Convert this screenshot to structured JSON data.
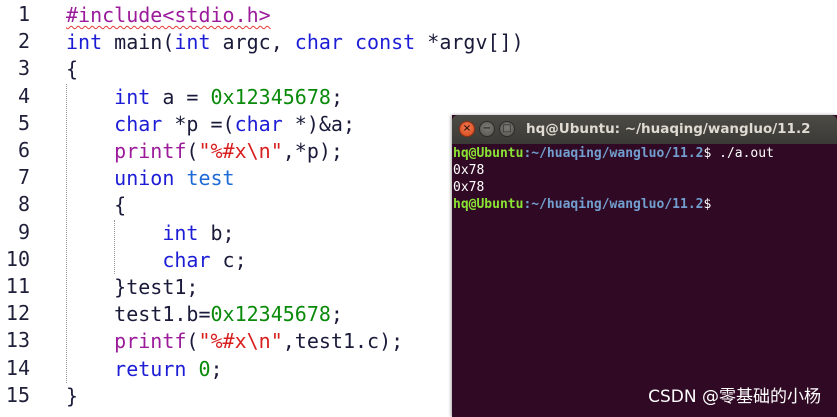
{
  "editor": {
    "line_numbers": [
      "1",
      "2",
      "3",
      "4",
      "5",
      "6",
      "7",
      "8",
      "9",
      "10",
      "11",
      "12",
      "13",
      "14",
      "15"
    ],
    "lines": [
      {
        "parts": [
          {
            "t": "#include<stdio.h>",
            "c": "pp squiggle"
          }
        ]
      },
      {
        "parts": [
          {
            "t": "int",
            "c": "type"
          },
          {
            "t": " main(",
            "c": ""
          },
          {
            "t": "int",
            "c": "type"
          },
          {
            "t": " argc, ",
            "c": ""
          },
          {
            "t": "char",
            "c": "type"
          },
          {
            "t": " ",
            "c": ""
          },
          {
            "t": "const",
            "c": "type"
          },
          {
            "t": " *argv[])",
            "c": ""
          }
        ]
      },
      {
        "parts": [
          {
            "t": "{",
            "c": ""
          }
        ]
      },
      {
        "parts": [
          {
            "t": "    ",
            "c": ""
          },
          {
            "t": "int",
            "c": "type"
          },
          {
            "t": " a = ",
            "c": ""
          },
          {
            "t": "0x12345678",
            "c": "num"
          },
          {
            "t": ";",
            "c": ""
          }
        ]
      },
      {
        "parts": [
          {
            "t": "    ",
            "c": ""
          },
          {
            "t": "char",
            "c": "type"
          },
          {
            "t": " *p =(",
            "c": ""
          },
          {
            "t": "char",
            "c": "type"
          },
          {
            "t": " *)&a;",
            "c": ""
          }
        ]
      },
      {
        "parts": [
          {
            "t": "    ",
            "c": ""
          },
          {
            "t": "printf",
            "c": "pp"
          },
          {
            "t": "(",
            "c": ""
          },
          {
            "t": "\"%#x\\n\"",
            "c": "str"
          },
          {
            "t": ",*p);",
            "c": ""
          }
        ]
      },
      {
        "parts": [
          {
            "t": "    ",
            "c": ""
          },
          {
            "t": "union",
            "c": "type"
          },
          {
            "t": " ",
            "c": ""
          },
          {
            "t": "test",
            "c": "uname"
          }
        ]
      },
      {
        "parts": [
          {
            "t": "    {",
            "c": ""
          }
        ]
      },
      {
        "parts": [
          {
            "t": "        ",
            "c": ""
          },
          {
            "t": "int",
            "c": "type"
          },
          {
            "t": " b;",
            "c": ""
          }
        ]
      },
      {
        "parts": [
          {
            "t": "        ",
            "c": ""
          },
          {
            "t": "char",
            "c": "type"
          },
          {
            "t": " c;",
            "c": ""
          }
        ]
      },
      {
        "parts": [
          {
            "t": "    }test1;",
            "c": ""
          }
        ]
      },
      {
        "parts": [
          {
            "t": "    test1.b=",
            "c": ""
          },
          {
            "t": "0x12345678",
            "c": "num"
          },
          {
            "t": ";",
            "c": ""
          }
        ]
      },
      {
        "parts": [
          {
            "t": "    ",
            "c": ""
          },
          {
            "t": "printf",
            "c": "pp"
          },
          {
            "t": "(",
            "c": ""
          },
          {
            "t": "\"%#x\\n\"",
            "c": "str"
          },
          {
            "t": ",test1.c);",
            "c": ""
          }
        ]
      },
      {
        "parts": [
          {
            "t": "    ",
            "c": ""
          },
          {
            "t": "return",
            "c": "type"
          },
          {
            "t": " ",
            "c": ""
          },
          {
            "t": "0",
            "c": "num"
          },
          {
            "t": ";",
            "c": ""
          }
        ]
      },
      {
        "parts": [
          {
            "t": "}",
            "c": ""
          }
        ]
      }
    ]
  },
  "terminal": {
    "title": "hq@Ubuntu: ~/huaqing/wangluo/11.2",
    "close_glyph": "×",
    "min_glyph": "−",
    "max_glyph": "□",
    "line1": {
      "user": "hq@Ubuntu",
      "path": ":~/huaqing/wangluo/11.2",
      "cmd": "$ ./a.out"
    },
    "line2": "0x78",
    "line3": "0x78",
    "line4": {
      "user": "hq@Ubuntu",
      "path": ":~/huaqing/wangluo/11.2",
      "cmd": "$"
    }
  },
  "watermark": "CSDN @零基础的小杨"
}
